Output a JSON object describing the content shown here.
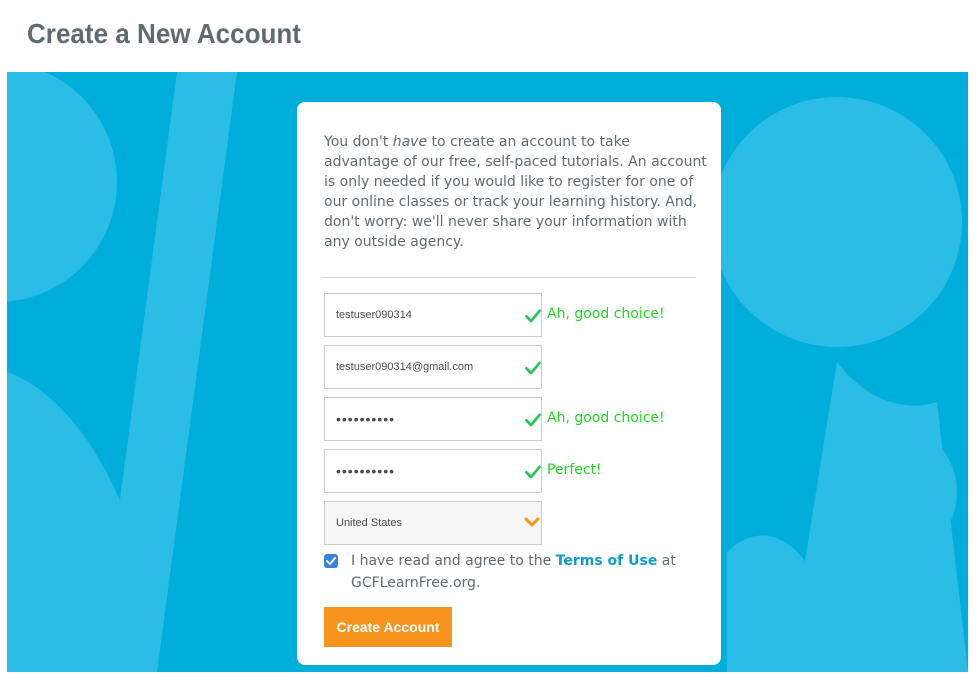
{
  "page": {
    "title": "Create a New Account"
  },
  "colors": {
    "banner": "#00aedb",
    "accent_button": "#f7941d",
    "valid_text": "#1fd61f",
    "check": "#22c95a",
    "link": "#0f9cc8",
    "checkbox": "#3b82dd"
  },
  "intro": {
    "before": "You don't ",
    "emphasis": "have",
    "after": " to create an account to take advantage of our free, self-paced tutorials. An account is only needed if you would like to register for one of our online classes or track your learning history. And, don't worry: we'll never share your information with any outside agency."
  },
  "form": {
    "username": {
      "value": "testuser090314",
      "icon": "check-icon",
      "message": "Ah, good choice!"
    },
    "email": {
      "value": "testuser090314@gmail.com",
      "icon": "check-icon",
      "message": ""
    },
    "password": {
      "value": "••••••••••",
      "icon": "check-icon",
      "message": "Ah, good choice!"
    },
    "confirm_password": {
      "value": "••••••••••",
      "icon": "check-icon",
      "message": "Perfect!"
    },
    "country": {
      "value": "United States",
      "icon": "chevron-down-icon"
    }
  },
  "terms": {
    "checked": true,
    "before": "I have read and agree to the ",
    "link": "Terms of Use",
    "after": " at GCFLearnFree.org."
  },
  "submit_label": "Create Account"
}
